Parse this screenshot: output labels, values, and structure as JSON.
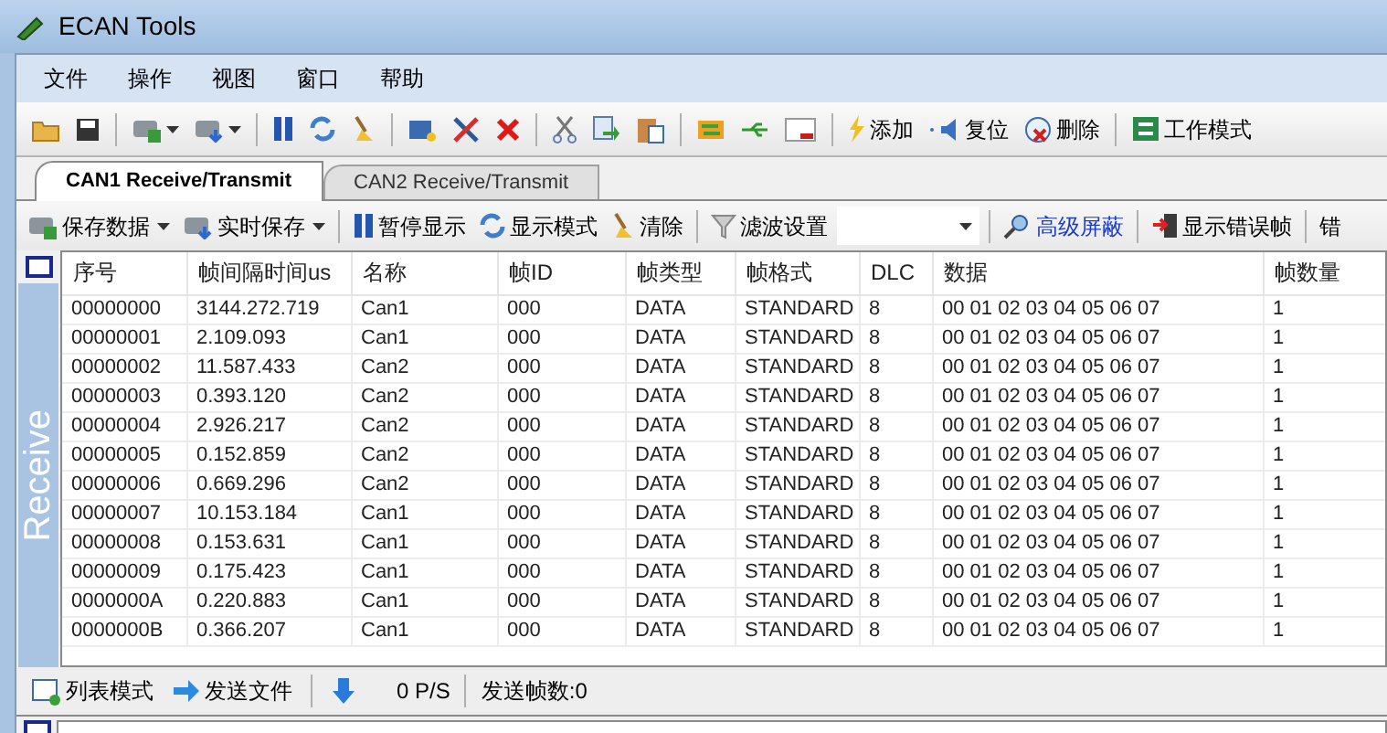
{
  "window": {
    "title": "ECAN Tools"
  },
  "menu": [
    "文件",
    "操作",
    "视图",
    "窗口",
    "帮助"
  ],
  "main_toolbar": {
    "buttons": [
      "添加",
      "复位",
      "删除",
      "工作模式"
    ]
  },
  "tabs": [
    {
      "label": "CAN1 Receive/Transmit",
      "selected": true
    },
    {
      "label": "CAN2 Receive/Transmit",
      "selected": false
    }
  ],
  "receive_toolbar": {
    "items": [
      {
        "kind": "button",
        "label": "保存数据",
        "has_menu": true,
        "highlighted": false
      },
      {
        "kind": "button",
        "label": "实时保存",
        "has_menu": true,
        "highlighted": false
      },
      {
        "kind": "button",
        "label": "暂停显示",
        "has_menu": false,
        "highlighted": false
      },
      {
        "kind": "button",
        "label": "显示模式",
        "has_menu": false,
        "highlighted": false
      },
      {
        "kind": "button",
        "label": "清除",
        "has_menu": false,
        "highlighted": false
      },
      {
        "kind": "button",
        "label": "滤波设置",
        "has_menu": false,
        "highlighted": false
      },
      {
        "kind": "combo"
      },
      {
        "kind": "button",
        "label": "高级屏蔽",
        "has_menu": false,
        "highlighted": true
      },
      {
        "kind": "button",
        "label": "显示错误帧",
        "has_menu": false,
        "highlighted": false
      },
      {
        "kind": "button",
        "label": "错",
        "has_menu": false,
        "highlighted": false
      }
    ]
  },
  "side_panel": {
    "label": "Receive"
  },
  "table": {
    "columns": [
      "序号",
      "帧间隔时间us",
      "名称",
      "帧ID",
      "帧类型",
      "帧格式",
      "DLC",
      "数据",
      "帧数量"
    ],
    "rows": [
      [
        "00000000",
        "3144.272.719",
        "Can1",
        "000",
        "DATA",
        "STANDARD",
        "8",
        "00 01 02 03 04 05 06 07",
        "1"
      ],
      [
        "00000001",
        "2.109.093",
        "Can1",
        "000",
        "DATA",
        "STANDARD",
        "8",
        "00 01 02 03 04 05 06 07",
        "1"
      ],
      [
        "00000002",
        "11.587.433",
        "Can2",
        "000",
        "DATA",
        "STANDARD",
        "8",
        "00 01 02 03 04 05 06 07",
        "1"
      ],
      [
        "00000003",
        "0.393.120",
        "Can2",
        "000",
        "DATA",
        "STANDARD",
        "8",
        "00 01 02 03 04 05 06 07",
        "1"
      ],
      [
        "00000004",
        "2.926.217",
        "Can2",
        "000",
        "DATA",
        "STANDARD",
        "8",
        "00 01 02 03 04 05 06 07",
        "1"
      ],
      [
        "00000005",
        "0.152.859",
        "Can2",
        "000",
        "DATA",
        "STANDARD",
        "8",
        "00 01 02 03 04 05 06 07",
        "1"
      ],
      [
        "00000006",
        "0.669.296",
        "Can2",
        "000",
        "DATA",
        "STANDARD",
        "8",
        "00 01 02 03 04 05 06 07",
        "1"
      ],
      [
        "00000007",
        "10.153.184",
        "Can1",
        "000",
        "DATA",
        "STANDARD",
        "8",
        "00 01 02 03 04 05 06 07",
        "1"
      ],
      [
        "00000008",
        "0.153.631",
        "Can1",
        "000",
        "DATA",
        "STANDARD",
        "8",
        "00 01 02 03 04 05 06 07",
        "1"
      ],
      [
        "00000009",
        "0.175.423",
        "Can1",
        "000",
        "DATA",
        "STANDARD",
        "8",
        "00 01 02 03 04 05 06 07",
        "1"
      ],
      [
        "0000000A",
        "0.220.883",
        "Can1",
        "000",
        "DATA",
        "STANDARD",
        "8",
        "00 01 02 03 04 05 06 07",
        "1"
      ],
      [
        "0000000B",
        "0.366.207",
        "Can1",
        "000",
        "DATA",
        "STANDARD",
        "8",
        "00 01 02 03 04 05 06 07",
        "1"
      ]
    ]
  },
  "send_toolbar": {
    "buttons": [
      "列表模式",
      "发送文件"
    ],
    "rate": "0 P/S",
    "sent_count": "发送帧数:0"
  }
}
